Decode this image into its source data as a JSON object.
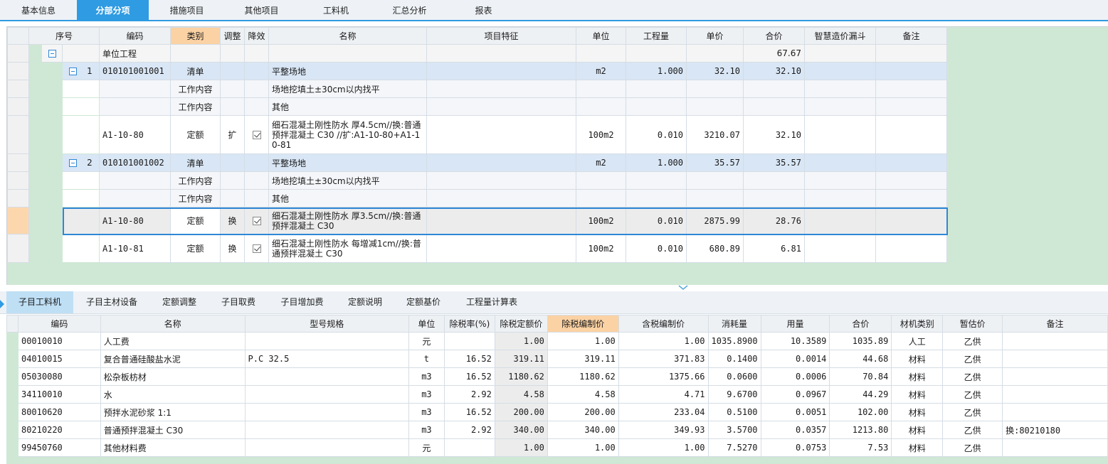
{
  "top_tabs": [
    "基本信息",
    "分部分项",
    "措施项目",
    "其他项目",
    "工料机",
    "汇总分析",
    "报表"
  ],
  "active_top_tab": 1,
  "main_headers": {
    "seq": "序号",
    "code": "编码",
    "type": "类别",
    "adjust": "调整",
    "reduce": "降效",
    "name": "名称",
    "feature": "项目特征",
    "unit": "单位",
    "qty": "工程量",
    "price": "单价",
    "total": "合价",
    "funnel": "智慧造价漏斗",
    "remark": "备注"
  },
  "main_rows": {
    "unit_project": {
      "code": "单位工程",
      "total": "67.67"
    },
    "item1": {
      "seq": "1",
      "code": "010101001001",
      "type": "清单",
      "name": "平整场地",
      "unit": "m2",
      "qty": "1.000",
      "price": "32.10",
      "total": "32.10"
    },
    "item1_work1": {
      "type": "工作内容",
      "name": "场地挖填土±30cm以内找平"
    },
    "item1_work2": {
      "type": "工作内容",
      "name": "其他"
    },
    "item1_quota": {
      "code": "A1-10-80",
      "type": "定额",
      "adjust": "扩",
      "name": "细石混凝土刚性防水 厚4.5cm//换:普通预拌混凝土 C30 //扩:A1-10-80+A1-10-81",
      "unit": "100m2",
      "qty": "0.010",
      "price": "3210.07",
      "total": "32.10"
    },
    "item2": {
      "seq": "2",
      "code": "010101001002",
      "type": "清单",
      "name": "平整场地",
      "unit": "m2",
      "qty": "1.000",
      "price": "35.57",
      "total": "35.57"
    },
    "item2_work1": {
      "type": "工作内容",
      "name": "场地挖填土±30cm以内找平"
    },
    "item2_work2": {
      "type": "工作内容",
      "name": "其他"
    },
    "item2_quota1": {
      "code": "A1-10-80",
      "type": "定额",
      "adjust": "换",
      "name": "细石混凝土刚性防水 厚3.5cm//换:普通预拌混凝土 C30",
      "unit": "100m2",
      "qty": "0.010",
      "price": "2875.99",
      "total": "28.76"
    },
    "item2_quota2": {
      "code": "A1-10-81",
      "type": "定额",
      "adjust": "换",
      "name": "细石混凝土刚性防水 每增减1cm//换:普通预拌混凝土 C30",
      "unit": "100m2",
      "qty": "0.010",
      "price": "680.89",
      "total": "6.81"
    }
  },
  "bottom_tabs": [
    "子目工料机",
    "子目主材设备",
    "定额调整",
    "子目取费",
    "子目增加费",
    "定额说明",
    "定额基价",
    "工程量计算表"
  ],
  "active_bottom_tab": 0,
  "sub_headers": {
    "code": "编码",
    "name": "名称",
    "spec": "型号规格",
    "unit": "单位",
    "tax_rate": "除税率(%)",
    "quota_price": "除税定额价",
    "edit_price": "除税编制价",
    "tax_edit_price": "含税编制价",
    "consumption": "消耗量",
    "usage": "用量",
    "total": "合价",
    "category": "材机类别",
    "est_price": "暂估价",
    "remark": "备注"
  },
  "sub_rows": [
    {
      "code": "00010010",
      "name": "人工费",
      "spec": "",
      "unit": "元",
      "tax_rate": "",
      "quota_price": "1.00",
      "edit_price": "1.00",
      "tax_edit_price": "1.00",
      "consumption": "1035.8900",
      "usage": "10.3589",
      "total": "1035.89",
      "category": "人工",
      "est_price": "乙供",
      "remark": ""
    },
    {
      "code": "04010015",
      "name": "复合普通硅酸盐水泥",
      "spec": "P.C 32.5",
      "unit": "t",
      "tax_rate": "16.52",
      "quota_price": "319.11",
      "edit_price": "319.11",
      "tax_edit_price": "371.83",
      "consumption": "0.1400",
      "usage": "0.0014",
      "total": "44.68",
      "category": "材料",
      "est_price": "乙供",
      "remark": ""
    },
    {
      "code": "05030080",
      "name": "松杂板枋材",
      "spec": "",
      "unit": "m3",
      "tax_rate": "16.52",
      "quota_price": "1180.62",
      "edit_price": "1180.62",
      "tax_edit_price": "1375.66",
      "consumption": "0.0600",
      "usage": "0.0006",
      "total": "70.84",
      "category": "材料",
      "est_price": "乙供",
      "remark": ""
    },
    {
      "code": "34110010",
      "name": "水",
      "spec": "",
      "unit": "m3",
      "tax_rate": "2.92",
      "quota_price": "4.58",
      "edit_price": "4.58",
      "tax_edit_price": "4.71",
      "consumption": "9.6700",
      "usage": "0.0967",
      "total": "44.29",
      "category": "材料",
      "est_price": "乙供",
      "remark": ""
    },
    {
      "code": "80010620",
      "name": "预拌水泥砂浆 1:1",
      "spec": "",
      "unit": "m3",
      "tax_rate": "16.52",
      "quota_price": "200.00",
      "edit_price": "200.00",
      "tax_edit_price": "233.04",
      "consumption": "0.5100",
      "usage": "0.0051",
      "total": "102.00",
      "category": "材料",
      "est_price": "乙供",
      "remark": ""
    },
    {
      "code": "80210220",
      "name": "普通预拌混凝土 C30",
      "spec": "",
      "unit": "m3",
      "tax_rate": "2.92",
      "quota_price": "340.00",
      "edit_price": "340.00",
      "tax_edit_price": "349.93",
      "consumption": "3.5700",
      "usage": "0.0357",
      "total": "1213.80",
      "category": "材料",
      "est_price": "乙供",
      "remark": "换:80210180"
    },
    {
      "code": "99450760",
      "name": "其他材料费",
      "spec": "",
      "unit": "元",
      "tax_rate": "",
      "quota_price": "1.00",
      "edit_price": "1.00",
      "tax_edit_price": "1.00",
      "consumption": "7.5270",
      "usage": "0.0753",
      "total": "7.53",
      "category": "材料",
      "est_price": "乙供",
      "remark": ""
    }
  ],
  "icons": {
    "collapse": "collapse-minus-icon",
    "checkbox": "checkbox-checked-icon",
    "splitter": "chevron-down-icon",
    "panel": "expand-arrow-icon"
  },
  "colors": {
    "accent": "#2f9be2",
    "selection_border": "#2f87d6",
    "list_row": "#d9e6f5",
    "panel_bg": "#cfe8d5",
    "highlight_header": "#fbd2a4"
  }
}
